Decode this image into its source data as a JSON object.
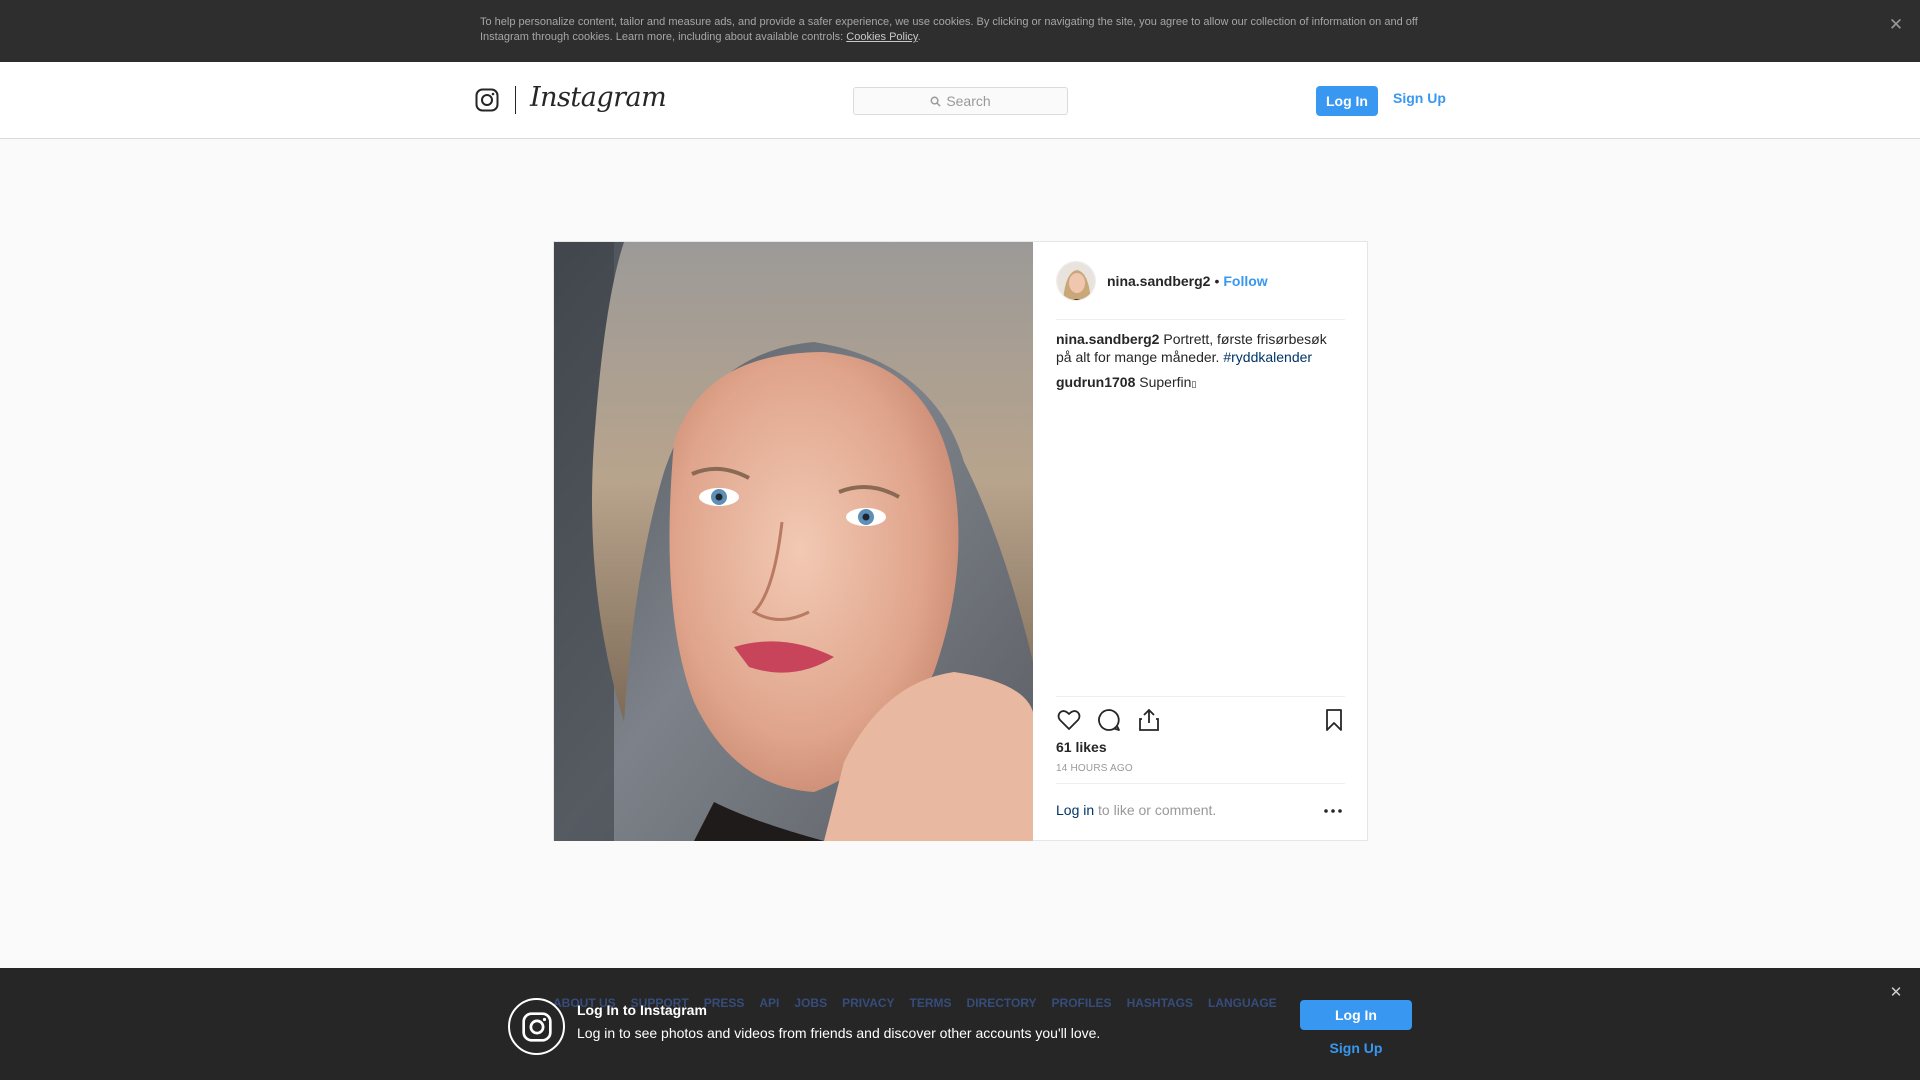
{
  "cookie_banner": {
    "text": "To help personalize content, tailor and measure ads, and provide a safer experience, we use cookies. By clicking or navigating the site, you agree to allow our collection of information on and off Instagram through cookies. Learn more, including about available controls: ",
    "link_label": "Cookies Policy",
    "trailing": ".",
    "close_glyph": "✕"
  },
  "header": {
    "wordmark": "Instagram",
    "search_placeholder": "Search",
    "login_label": "Log In",
    "signup_label": "Sign Up"
  },
  "post": {
    "author": "nina.sandberg2",
    "separator": "•",
    "follow_label": "Follow",
    "caption_user": "nina.sandberg2",
    "caption_text": " Portrett, første frisørbesøk på alt for mange måneder. ",
    "hashtag": "#ryddkalender",
    "comment_user": "gudrun1708",
    "comment_text": " Superfin",
    "likes": "61 likes",
    "timestamp": "14 HOURS AGO",
    "login_link": "Log in",
    "login_prompt": " to like or comment.",
    "icons": [
      "heart-icon",
      "comment-icon",
      "share-icon",
      "bookmark-icon",
      "more-icon"
    ]
  },
  "footer": {
    "links": [
      "ABOUT US",
      "SUPPORT",
      "PRESS",
      "API",
      "JOBS",
      "PRIVACY",
      "TERMS",
      "DIRECTORY",
      "PROFILES",
      "HASHTAGS",
      "LANGUAGE"
    ]
  },
  "login_overlay": {
    "title": "Log In to Instagram",
    "description": "Log in to see photos and videos from friends and discover other accounts you'll love.",
    "login_label": "Log In",
    "signup_label": "Sign Up",
    "close_glyph": "✕"
  },
  "colors": {
    "accent": "#3897f0",
    "link_dark": "#003569",
    "banner_bg": "#2e2e2e"
  }
}
